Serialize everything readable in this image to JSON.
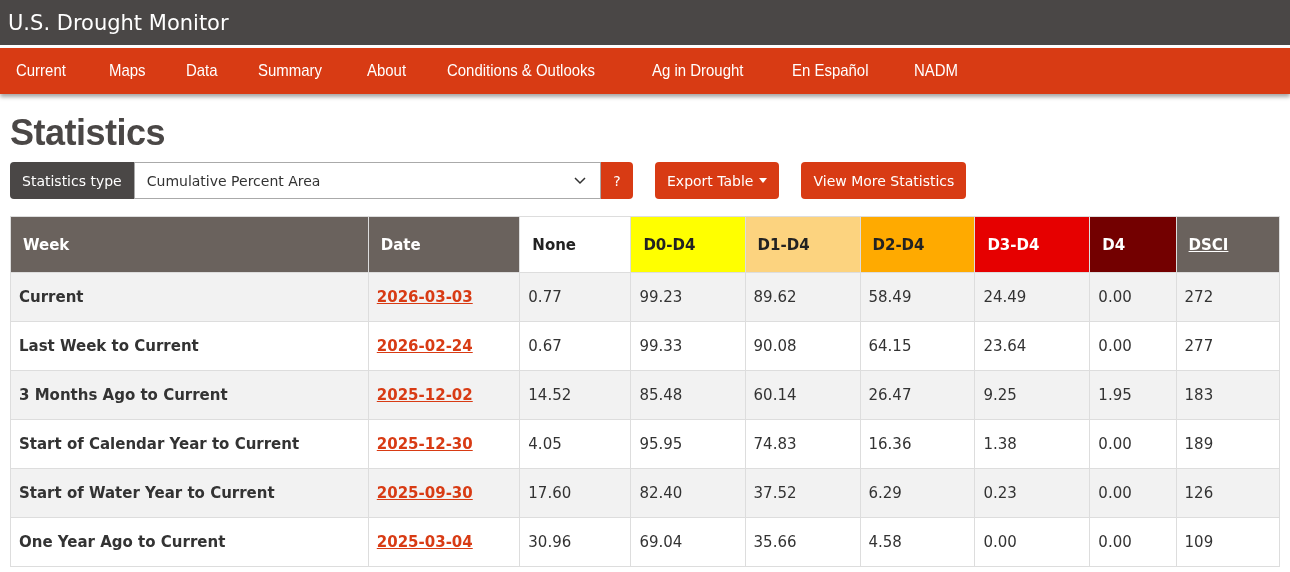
{
  "site_title": "U.S. Drought Monitor",
  "nav": [
    {
      "label": "Current"
    },
    {
      "label": "Maps"
    },
    {
      "label": "Data"
    },
    {
      "label": "Summary"
    },
    {
      "label": "About"
    },
    {
      "label": "Conditions & Outlooks"
    },
    {
      "label": "Ag in Drought"
    },
    {
      "label": "En Español"
    },
    {
      "label": "NADM"
    }
  ],
  "page_title": "Statistics",
  "statistics_type": {
    "label": "Statistics type",
    "value": "Cumulative Percent Area",
    "help": "?"
  },
  "buttons": [
    {
      "label": "Export Table",
      "dropdown": true
    },
    {
      "label": "View More Statistics",
      "dropdown": false
    }
  ],
  "table": {
    "columns": [
      {
        "label": "Week",
        "color": "#6a625d",
        "kind": "text"
      },
      {
        "label": "Date",
        "color": "#6a625d",
        "kind": "text"
      },
      {
        "label": "None",
        "color": "#ffffff",
        "kind": "text"
      },
      {
        "label": "D0-D4",
        "color": "#ffff00",
        "kind": "text"
      },
      {
        "label": "D1-D4",
        "color": "#fcd37f",
        "kind": "text"
      },
      {
        "label": "D2-D4",
        "color": "#ffaa00",
        "kind": "text"
      },
      {
        "label": "D3-D4",
        "color": "#e60000",
        "kind": "text"
      },
      {
        "label": "D4",
        "color": "#730000",
        "kind": "text"
      },
      {
        "label": "DSCI",
        "color": "#6a625d",
        "kind": "link"
      }
    ],
    "rows": [
      {
        "week": "Current",
        "date": "2026-03-03",
        "values": [
          "0.77",
          "99.23",
          "89.62",
          "58.49",
          "24.49",
          "0.00",
          "272"
        ]
      },
      {
        "week": "Last Week to Current",
        "date": "2026-02-24",
        "values": [
          "0.67",
          "99.33",
          "90.08",
          "64.15",
          "23.64",
          "0.00",
          "277"
        ]
      },
      {
        "week": "3 Months Ago to Current",
        "date": "2025-12-02",
        "values": [
          "14.52",
          "85.48",
          "60.14",
          "26.47",
          "9.25",
          "1.95",
          "183"
        ]
      },
      {
        "week": "Start of Calendar Year to Current",
        "date": "2025-12-30",
        "values": [
          "4.05",
          "95.95",
          "74.83",
          "16.36",
          "1.38",
          "0.00",
          "189"
        ]
      },
      {
        "week": "Start of Water Year to Current",
        "date": "2025-09-30",
        "values": [
          "17.60",
          "82.40",
          "37.52",
          "6.29",
          "0.23",
          "0.00",
          "126"
        ]
      },
      {
        "week": "One Year Ago to Current",
        "date": "2025-03-04",
        "values": [
          "30.96",
          "69.04",
          "35.66",
          "4.58",
          "0.00",
          "0.00",
          "109"
        ]
      }
    ]
  }
}
